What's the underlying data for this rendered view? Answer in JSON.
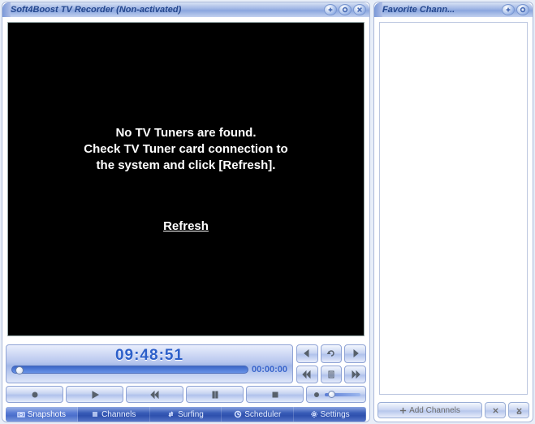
{
  "main_window": {
    "title": "Soft4Boost TV Recorder (Non-activated)",
    "message_line1": "No TV Tuners are found.",
    "message_line2": "Check TV Tuner card connection to",
    "message_line3": "the system and click [Refresh].",
    "refresh_label": "Refresh",
    "clock": "09:48:51",
    "counter": "00:00:00"
  },
  "tabs": {
    "snapshots": "Snapshots",
    "channels": "Channels",
    "surfing": "Surfing",
    "scheduler": "Scheduler",
    "settings": "Settings"
  },
  "side_window": {
    "title": "Favorite Chann...",
    "add_channels": "Add Channels"
  }
}
